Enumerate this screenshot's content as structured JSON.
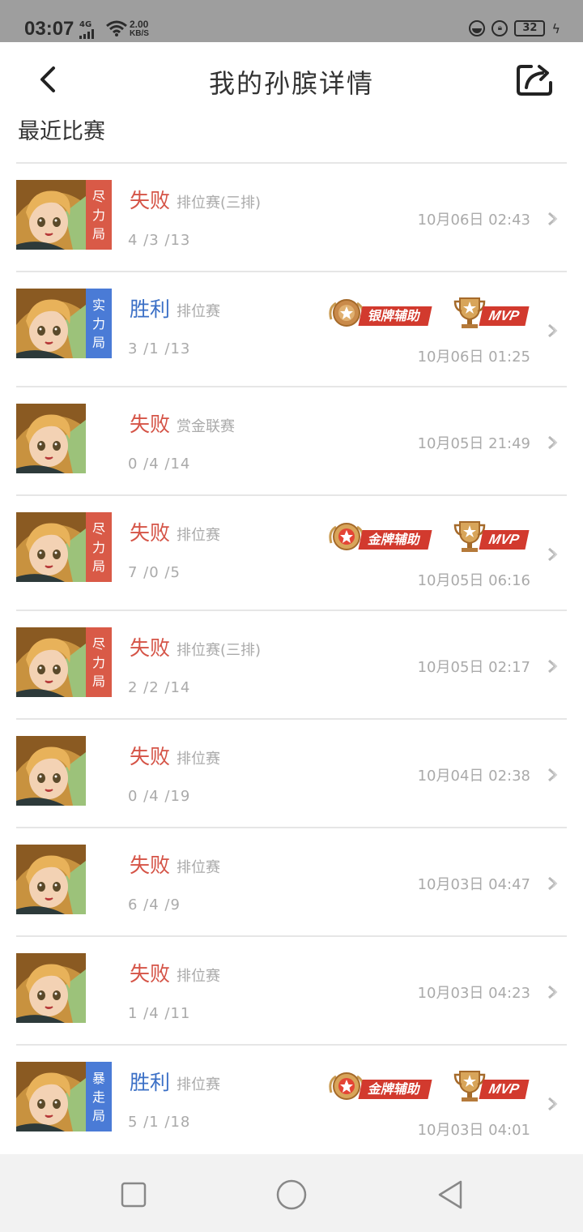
{
  "status_bar": {
    "time": "03:07",
    "network": "4G",
    "speed_value": "2.00",
    "speed_unit": "KB/S",
    "battery": "32"
  },
  "header": {
    "title": "我的孙膑详情",
    "back_icon": "back-chevron-icon",
    "share_icon": "share-icon"
  },
  "section": {
    "title": "最近比赛"
  },
  "matches": [
    {
      "tag": [
        "尽",
        "力",
        "局"
      ],
      "tag_color": "#d95a47",
      "result": "失败",
      "result_type": "lose",
      "mode": "排位赛(三排)",
      "kda": "4 /3 /13",
      "datetime": "10月06日 02:43",
      "badges": []
    },
    {
      "tag": [
        "实",
        "力",
        "局"
      ],
      "tag_color": "#4a7bd6",
      "result": "胜利",
      "result_type": "win",
      "mode": "排位赛",
      "kda": "3 /1 /13",
      "datetime": "10月06日 01:25",
      "badges": [
        "银牌辅助",
        "MVP"
      ]
    },
    {
      "tag": [],
      "tag_color": "",
      "result": "失败",
      "result_type": "lose",
      "mode": "赏金联赛",
      "kda": "0 /4 /14",
      "datetime": "10月05日 21:49",
      "badges": []
    },
    {
      "tag": [
        "尽",
        "力",
        "局"
      ],
      "tag_color": "#d95a47",
      "result": "失败",
      "result_type": "lose",
      "mode": "排位赛",
      "kda": "7 /0 /5",
      "datetime": "10月05日 06:16",
      "badges": [
        "金牌辅助",
        "MVP"
      ]
    },
    {
      "tag": [
        "尽",
        "力",
        "局"
      ],
      "tag_color": "#d95a47",
      "result": "失败",
      "result_type": "lose",
      "mode": "排位赛(三排)",
      "kda": "2 /2 /14",
      "datetime": "10月05日 02:17",
      "badges": []
    },
    {
      "tag": [],
      "tag_color": "",
      "result": "失败",
      "result_type": "lose",
      "mode": "排位赛",
      "kda": "0 /4 /19",
      "datetime": "10月04日 02:38",
      "badges": []
    },
    {
      "tag": [],
      "tag_color": "",
      "result": "失败",
      "result_type": "lose",
      "mode": "排位赛",
      "kda": "6 /4 /9",
      "datetime": "10月03日 04:47",
      "badges": []
    },
    {
      "tag": [],
      "tag_color": "",
      "result": "失败",
      "result_type": "lose",
      "mode": "排位赛",
      "kda": "1 /4 /11",
      "datetime": "10月03日 04:23",
      "badges": []
    },
    {
      "tag": [
        "暴",
        "走",
        "局"
      ],
      "tag_color": "#4a7bd6",
      "result": "胜利",
      "result_type": "win",
      "mode": "排位赛",
      "kda": "5 /1 /18",
      "datetime": "10月03日 04:01",
      "badges": [
        "金牌辅助",
        "MVP"
      ]
    }
  ],
  "nav": {
    "recents_icon": "square-icon",
    "home_icon": "circle-icon",
    "back_icon": "triangle-back-icon"
  },
  "colors": {
    "lose": "#d55447",
    "win": "#3a6fc6",
    "tag_red": "#d95a47",
    "tag_blue": "#4a7bd6",
    "badge_red": "#d23a2e",
    "badge_gold": "#d9a24b"
  }
}
